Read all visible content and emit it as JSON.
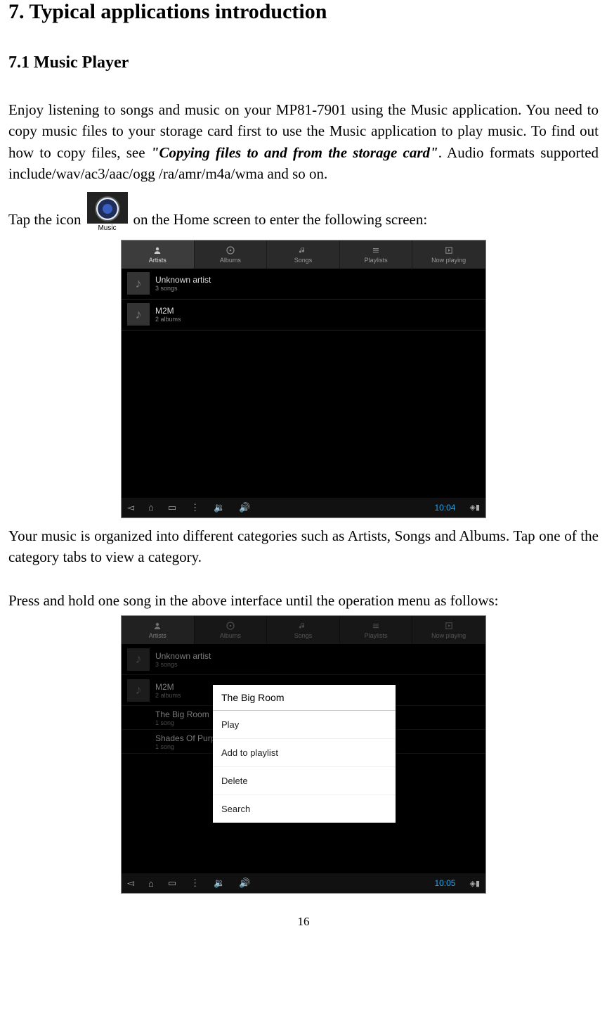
{
  "heading": "7. Typical applications introduction",
  "subheading": "7.1 Music Player",
  "para1_a": "Enjoy listening to songs and music on your MP81-7901 using the Music application. You need to copy music files to your storage card first to use the Music application to play music. To find out how to copy files, see ",
  "para1_emph": "\"Copying files to and from the storage card\"",
  "para1_b": ". Audio formats supported include/wav/ac3/aac/ogg /ra/amr/m4a/wma and so on.",
  "tap_before": "Tap the icon",
  "music_icon_label": "Music",
  "tap_after": " on the Home screen to enter the following screen:",
  "para2": "Your music is organized into different categories such as Artists, Songs and Albums. Tap one of the category tabs to view a category.",
  "para3": "Press and hold one song in the above interface until the operation menu as follows:",
  "page_number": "16",
  "screenshot1": {
    "tabs": [
      {
        "label": "Artists",
        "active": true
      },
      {
        "label": "Albums",
        "active": false
      },
      {
        "label": "Songs",
        "active": false
      },
      {
        "label": "Playlists",
        "active": false
      },
      {
        "label": "Now playing",
        "active": false
      }
    ],
    "rows": [
      {
        "name": "Unknown artist",
        "sub": "3 songs"
      },
      {
        "name": "M2M",
        "sub": "2 albums"
      }
    ],
    "clock": "10:04"
  },
  "screenshot2": {
    "tabs": [
      {
        "label": "Artists",
        "active": true
      },
      {
        "label": "Albums",
        "active": false
      },
      {
        "label": "Songs",
        "active": false
      },
      {
        "label": "Playlists",
        "active": false
      },
      {
        "label": "Now playing",
        "active": false
      }
    ],
    "rows": [
      {
        "name": "Unknown artist",
        "sub": "3 songs"
      },
      {
        "name": "M2M",
        "sub": "2 albums"
      },
      {
        "name": "The Big Room",
        "sub": "1 song",
        "expanded": true
      },
      {
        "name": "Shades Of Purple",
        "sub": "1 song",
        "expanded": true
      }
    ],
    "menu": {
      "title": "The Big Room",
      "items": [
        "Play",
        "Add to playlist",
        "Delete",
        "Search"
      ]
    },
    "clock": "10:05"
  }
}
